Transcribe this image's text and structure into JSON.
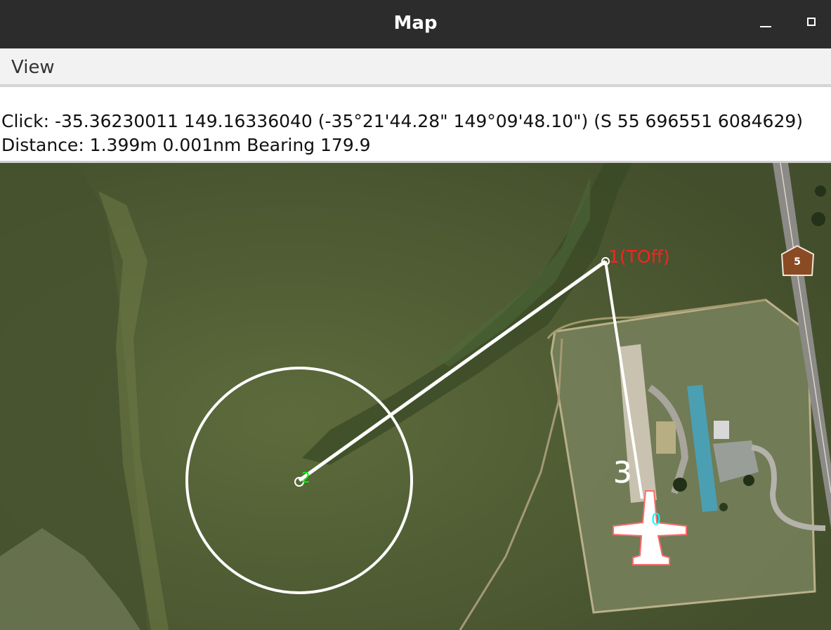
{
  "window": {
    "title": "Map"
  },
  "menu": {
    "view_label": "View"
  },
  "info": {
    "click_line": "Click: -35.36230011 149.16336040 (-35°21'44.28\" 149°09'48.10\") (S 55 696551 6084629)",
    "distance_line": "Distance: 1.399m 0.001nm Bearing 179.9"
  },
  "map": {
    "waypoints": [
      {
        "label": "0",
        "color": "#00ffff"
      },
      {
        "label": "1(TOff)",
        "color": "#ff2020"
      },
      {
        "label": "2",
        "color": "#00ff00"
      },
      {
        "label": "3",
        "color": "#ffffff"
      }
    ],
    "road_marker": "5",
    "icons": [
      "plane-icon",
      "road-marker-icon"
    ],
    "colors": {
      "route": "#ffffff",
      "grass": "#4f5e32",
      "takeoff_label": "#ff2020"
    }
  }
}
